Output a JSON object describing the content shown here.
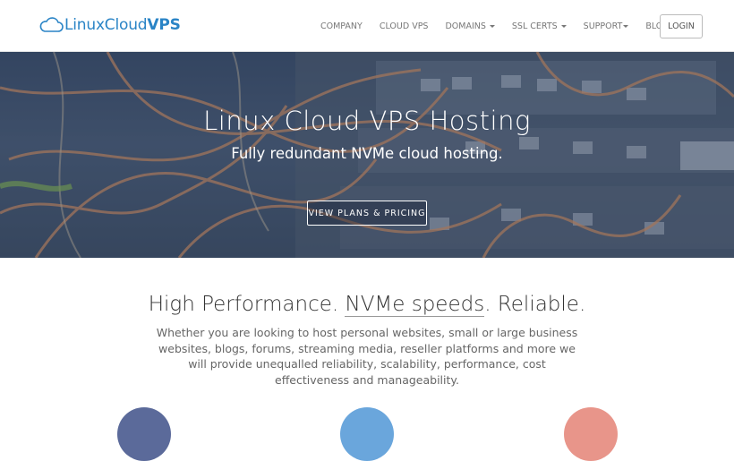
{
  "brand": {
    "name_light": "LinuxCloud",
    "name_bold": "VPS",
    "logo_icon": "cloud-icon"
  },
  "nav": {
    "items": [
      {
        "label": "Company",
        "dropdown": false
      },
      {
        "label": "Cloud VPS",
        "dropdown": false
      },
      {
        "label": "Domains",
        "dropdown": true
      },
      {
        "label": "SSL Certs",
        "dropdown": true
      },
      {
        "label": "Support",
        "dropdown": true
      },
      {
        "label": "Blog",
        "dropdown": false
      }
    ],
    "login_label": "Login"
  },
  "hero": {
    "title": "Linux Cloud VPS Hosting",
    "subtitle": "Fully redundant NVMe cloud hosting.",
    "cta_label": "View Plans & Pricing"
  },
  "features": {
    "title_before": "High Performance. ",
    "title_highlight": "NVMe speeds",
    "title_after": ". Reliable.",
    "body": "Whether you are looking to host personal websites, small or large business websites, blogs, forums, streaming media, reseller platforms and more we will provide unequalled reliability, scalability, performance, cost effectiveness and manageability."
  },
  "colors": {
    "brand_blue": "#2a84c6",
    "circle_1": "#5b6a9a",
    "circle_2": "#6aa6dc",
    "circle_3": "#e8958a"
  }
}
